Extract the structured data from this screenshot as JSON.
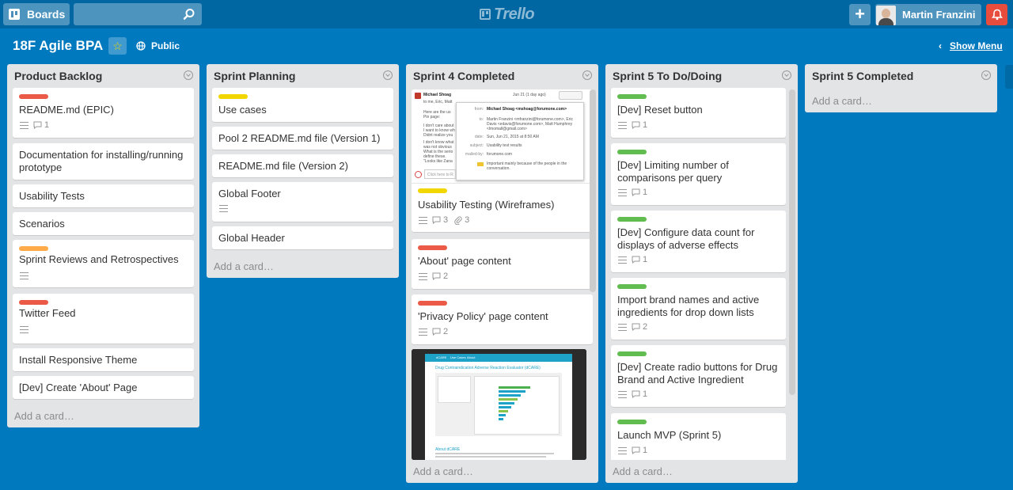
{
  "topbar": {
    "boards_label": "Boards",
    "search_placeholder": "",
    "logo_text": "Trello",
    "add_label": "+",
    "member_name": "Martin Franzini"
  },
  "board": {
    "title": "18F Agile BPA",
    "visibility": "Public",
    "show_menu": "Show Menu"
  },
  "add_card_label": "Add a card…",
  "colors": {
    "green": "#61bd4f",
    "yellow": "#f2d600",
    "orange": "#ffab4a",
    "red": "#eb5a46"
  },
  "lists": [
    {
      "title": "Product Backlog",
      "cards": [
        {
          "title": "README.md (EPIC)",
          "label": "red",
          "desc": true,
          "comments": "1"
        },
        {
          "title": "Documentation for installing/running prototype"
        },
        {
          "title": "Usability Tests"
        },
        {
          "title": "Scenarios"
        },
        {
          "title": "Sprint Reviews and Retrospectives",
          "label": "orange",
          "desc": true
        },
        {
          "title": "Twitter Feed",
          "label": "red",
          "desc": true
        },
        {
          "title": "Install Responsive Theme"
        },
        {
          "title": "[Dev] Create 'About' Page"
        }
      ]
    },
    {
      "title": "Sprint Planning",
      "cards": [
        {
          "title": "Use cases",
          "label": "yellow"
        },
        {
          "title": "Pool 2 README.md file (Version 1)"
        },
        {
          "title": "README.md file (Version 2)"
        },
        {
          "title": "Global Footer",
          "desc": true
        },
        {
          "title": "Global Header"
        }
      ]
    },
    {
      "title": "Sprint 4 Completed",
      "cards": [
        {
          "title": "Usability Testing (Wireframes)",
          "label": "yellow",
          "desc": true,
          "comments": "3",
          "attachments": "3",
          "cover": "email"
        },
        {
          "title": "'About' page content",
          "label": "red",
          "desc": true,
          "comments": "2"
        },
        {
          "title": "'Privacy Policy' page content",
          "label": "red",
          "desc": true,
          "comments": "2"
        },
        {
          "cover": "screenshot"
        }
      ],
      "email_cover": {
        "sender": "Michael Shoag",
        "date_short": "Jun 21 (1 day ago)",
        "to_line": "to me, Eric, Matt",
        "body": [
          "Here are the us",
          "Pin page:",
          "I don't care about",
          "I want to know wh",
          "Didnt realize you",
          "I don't know what",
          "was not obvious",
          "What is the serio",
          "define these.",
          "\"Looks like Zana"
        ],
        "fields": [
          {
            "k": "from:",
            "v": "Michael Shoag <mshoag@forumone.com>"
          },
          {
            "k": "to:",
            "v": "Martin Franzini <mfranzini@forumone.com>, Eric Davis <edavis@forumone.com>, Matt Humphrey <lmomall@gmail.com>"
          },
          {
            "k": "date:",
            "v": "Sun, Jun 21, 2015 at 8:50 AM"
          },
          {
            "k": "subject:",
            "v": "Usability test results"
          },
          {
            "k": "mailed-by:",
            "v": "forumone.com"
          },
          {
            "k": "",
            "v": "Important mainly because of the people in the conversation."
          }
        ],
        "reply_hint": "Click here to R"
      },
      "screenshot_cover": {
        "nav": [
          "dCARE",
          "Use Cases",
          "About"
        ],
        "heading": "Drug Contraindication Adverse Reaction Evaluator (dCARE)",
        "about_title": "About dCARE"
      }
    },
    {
      "title": "Sprint 5 To Do/Doing",
      "cards": [
        {
          "title": "[Dev] Reset button",
          "label": "green",
          "desc": true,
          "comments": "1"
        },
        {
          "title": "[Dev] Limiting number of comparisons per query",
          "label": "green",
          "desc": true,
          "comments": "1"
        },
        {
          "title": "[Dev] Configure data count for displays of adverse effects",
          "label": "green",
          "desc": true,
          "comments": "1"
        },
        {
          "title": "Import brand names and active ingredients for drop down lists",
          "label": "green",
          "desc": true,
          "comments": "2"
        },
        {
          "title": "[Dev] Create radio buttons for Drug Brand and Active Ingredient",
          "label": "green",
          "desc": true,
          "comments": "1"
        },
        {
          "title": "Launch MVP (Sprint 5)",
          "label": "green",
          "desc": true,
          "comments": "1"
        }
      ]
    },
    {
      "title": "Sprint 5 Completed",
      "cards": []
    }
  ]
}
